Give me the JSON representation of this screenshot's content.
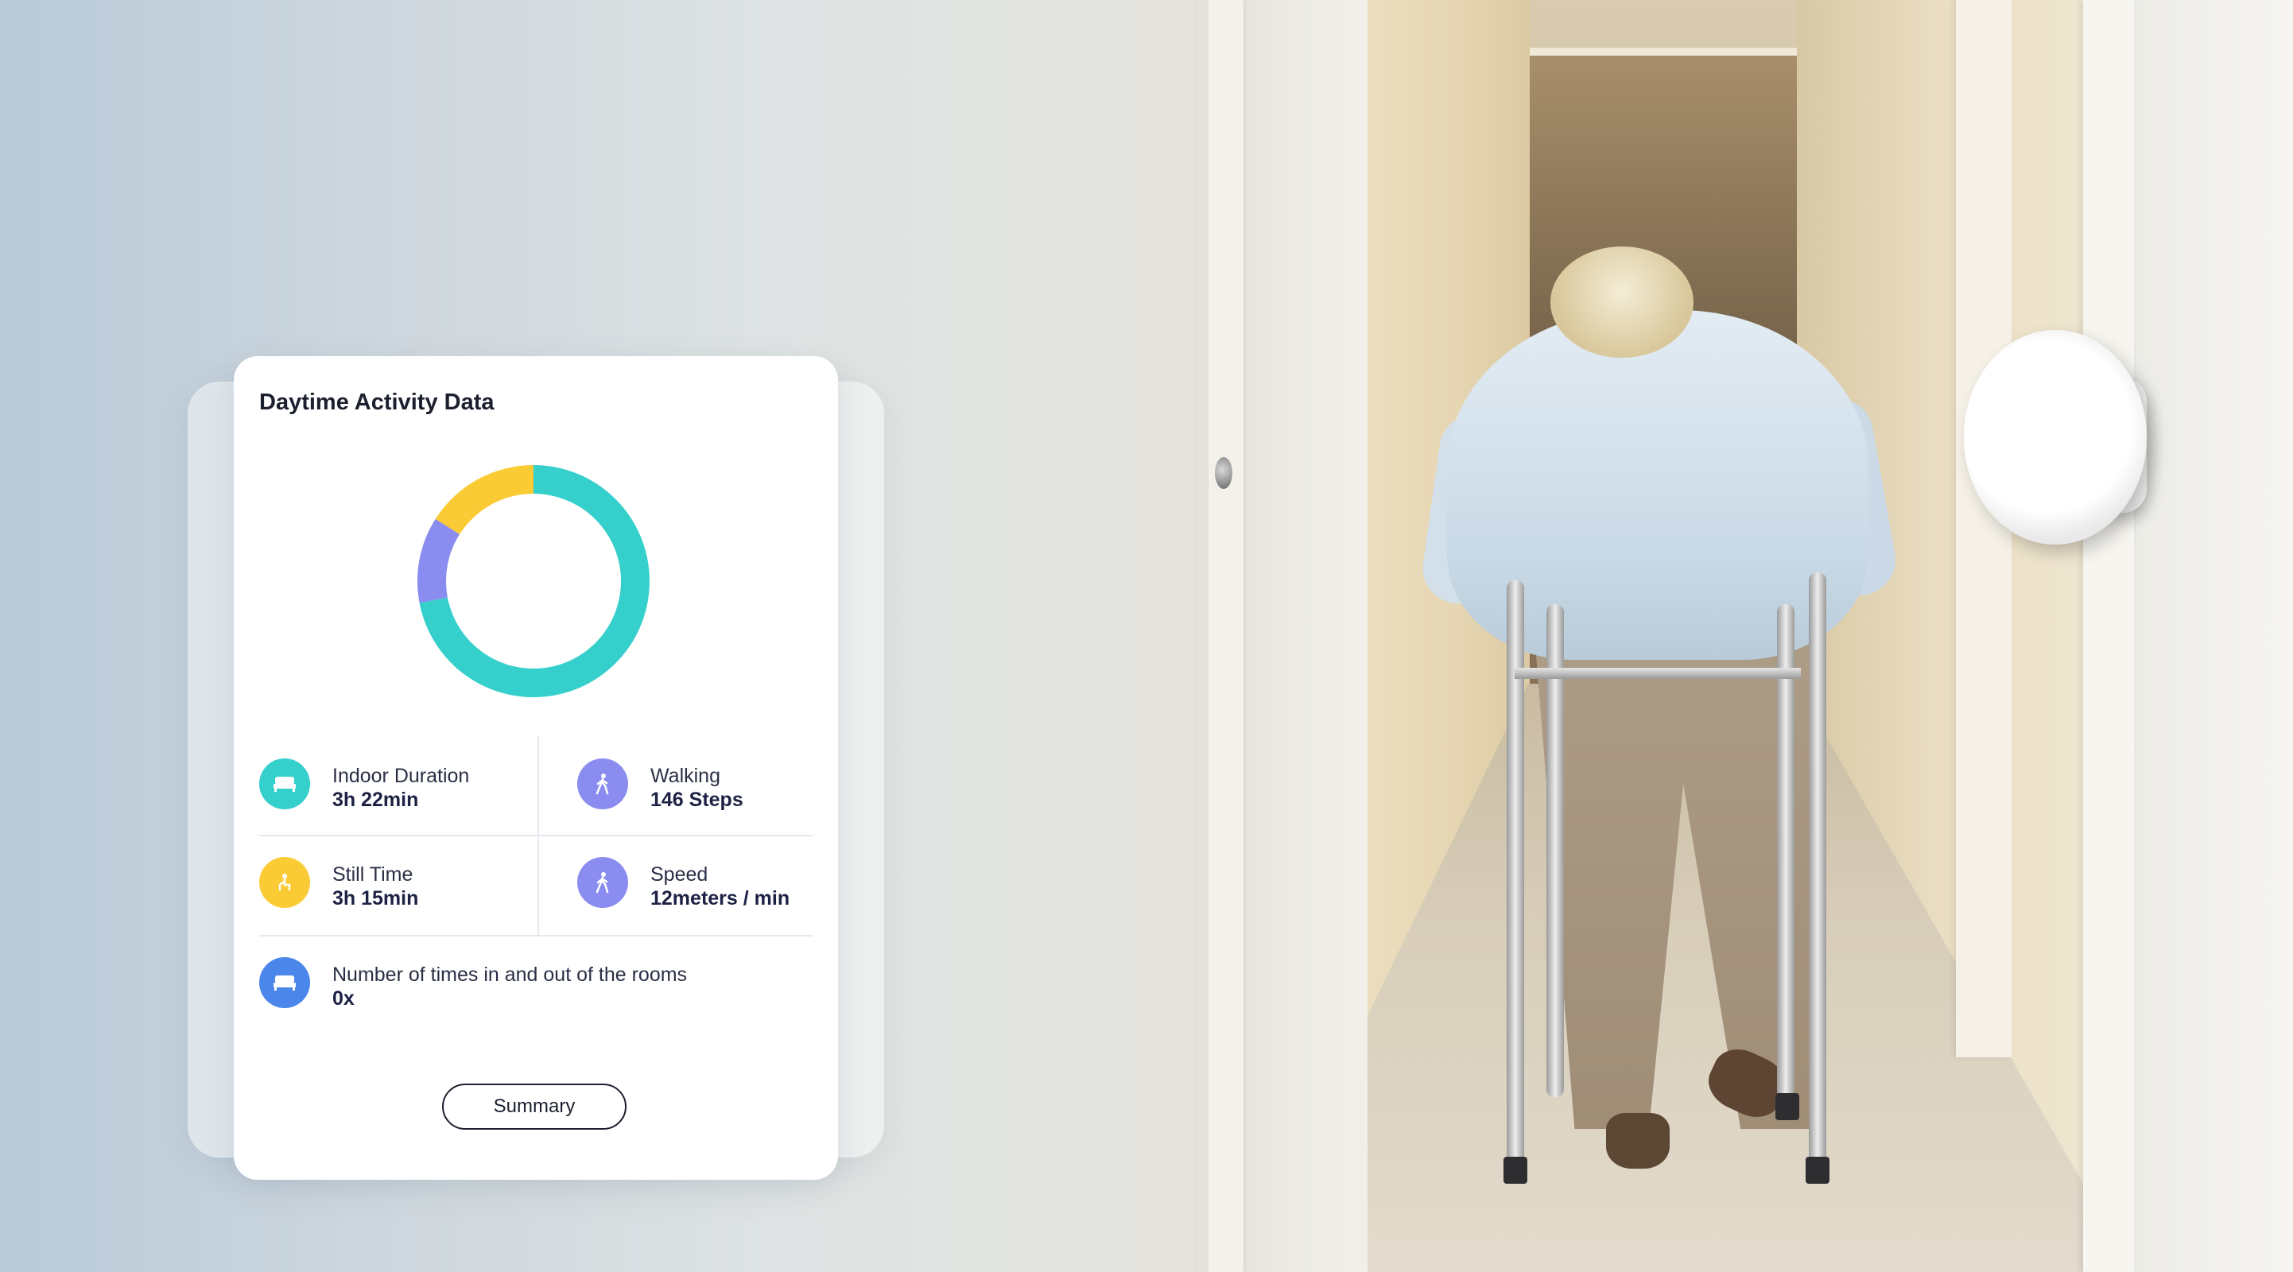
{
  "card": {
    "title": "Daytime Activity Data",
    "summary_label": "Summary"
  },
  "colors": {
    "teal": "#35cfcc",
    "purple": "#8a8cf0",
    "yellow": "#fbcb35",
    "blue": "#4b86ea"
  },
  "chart_data": {
    "type": "pie",
    "style": "donut",
    "slices": [
      {
        "value": 72,
        "color": "#35cfcc"
      },
      {
        "value": 12,
        "color": "#8a8cf0"
      },
      {
        "value": 16,
        "color": "#fbcb35"
      }
    ]
  },
  "metrics": {
    "indoor": {
      "label": "Indoor Duration",
      "value": "3h 22min",
      "icon": "bed-icon"
    },
    "walking": {
      "label": "Walking",
      "value": "146 Steps",
      "icon": "walking-person-icon"
    },
    "still": {
      "label": "Still Time",
      "value": "3h 15min",
      "icon": "sitting-person-icon"
    },
    "speed": {
      "label": "Speed",
      "value": "12meters / min",
      "icon": "walking-person-icon"
    },
    "rooms": {
      "label": "Number of times in and out of the rooms",
      "value": "0x",
      "icon": "bed-icon"
    }
  }
}
